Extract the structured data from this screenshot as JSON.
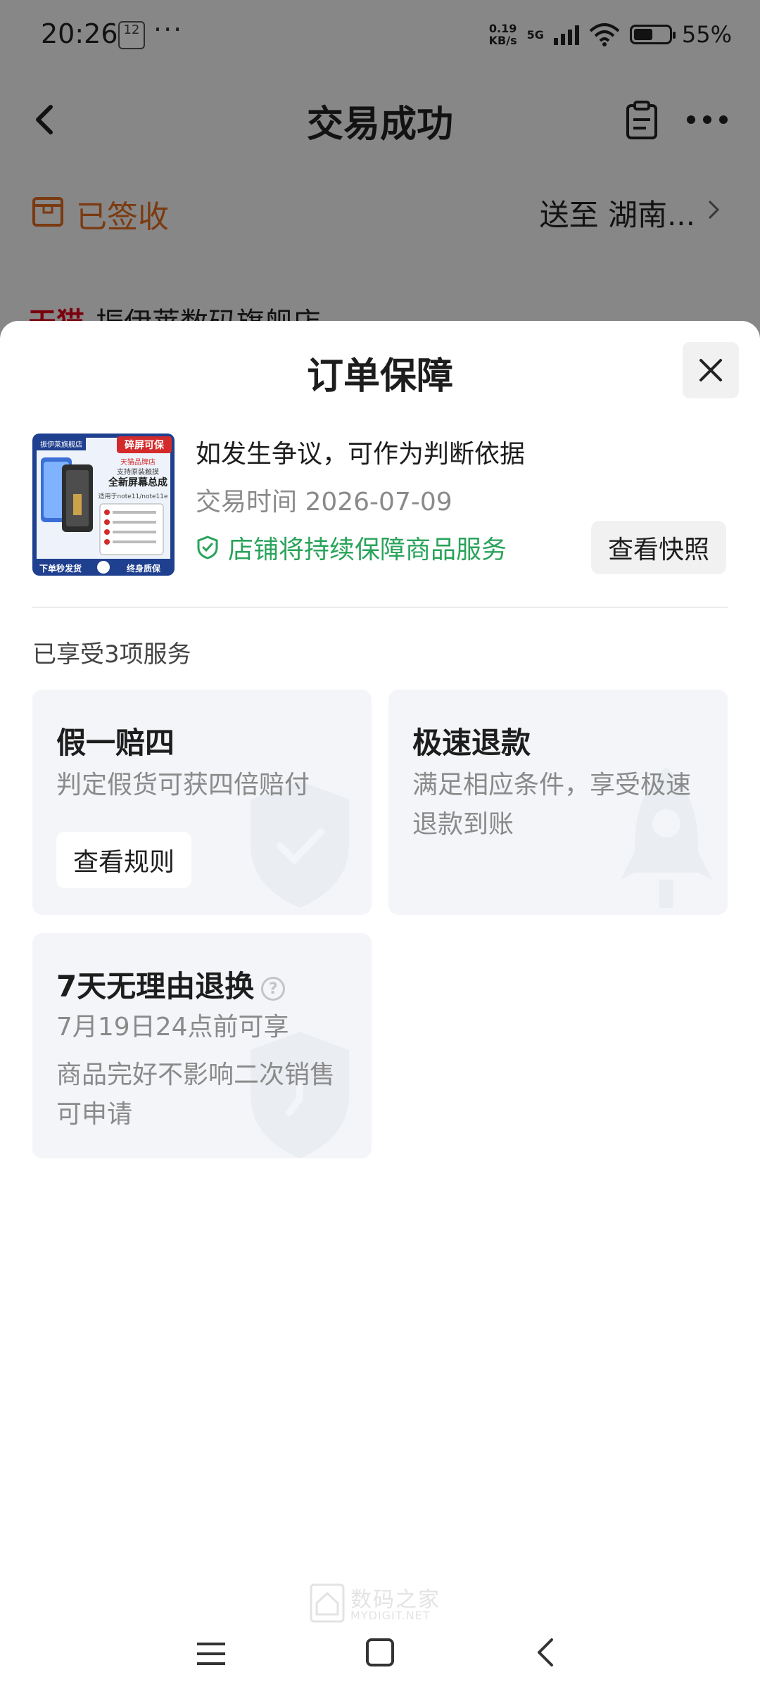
{
  "status_bar": {
    "time": "20:26",
    "notification_badge": "12",
    "more_dots": "···",
    "net_speed": "0.19",
    "net_speed_unit": "KB/s",
    "network": "5G",
    "battery_percent": 55,
    "battery_text": "55%"
  },
  "header": {
    "title": "交易成功",
    "back_icon": "chevron-left-icon",
    "order_icon": "clipboard-icon",
    "more_icon": "more-horizontal-icon"
  },
  "delivery": {
    "status": "已签收",
    "ship_to": "送至  湖南..."
  },
  "shop": {
    "logo": "天猫",
    "name": "振伊莱数码旗舰店"
  },
  "sheet": {
    "title": "订单保障",
    "close_icon": "close-icon",
    "product": {
      "line1": "如发生争议，可作为判断依据",
      "trade_time": "交易时间 2026-07-09",
      "guarantee": "店铺将持续保障商品服务",
      "snapshot_button": "查看快照",
      "image": {
        "tag": "碎屏可保",
        "shop_label": "振伊莱旗舰店",
        "brand": "天猫品牌店",
        "headline": "全新屏幕总成",
        "sub": "支持原装触摸",
        "model": "适用于note11/note11e",
        "bottom_left": "下单秒发货",
        "bottom_right": "终身质保"
      }
    },
    "services_count": "已享受3项服务",
    "services": [
      {
        "title": "假一赔四",
        "desc": "判定假货可获四倍赔付",
        "button": "查看规则"
      },
      {
        "title": "极速退款",
        "desc": "满足相应条件，享受极速退款到账"
      },
      {
        "title": "7天无理由退换",
        "deadline": "7月19日24点前可享",
        "desc": "商品完好不影响二次销售可申请"
      }
    ]
  },
  "watermark": {
    "text": "数码之家",
    "sub": "MYDIGIT.NET"
  },
  "colors": {
    "accent_orange": "#e06a1e",
    "guarantee_green": "#29a35a",
    "tmall_red": "#e0001b"
  }
}
